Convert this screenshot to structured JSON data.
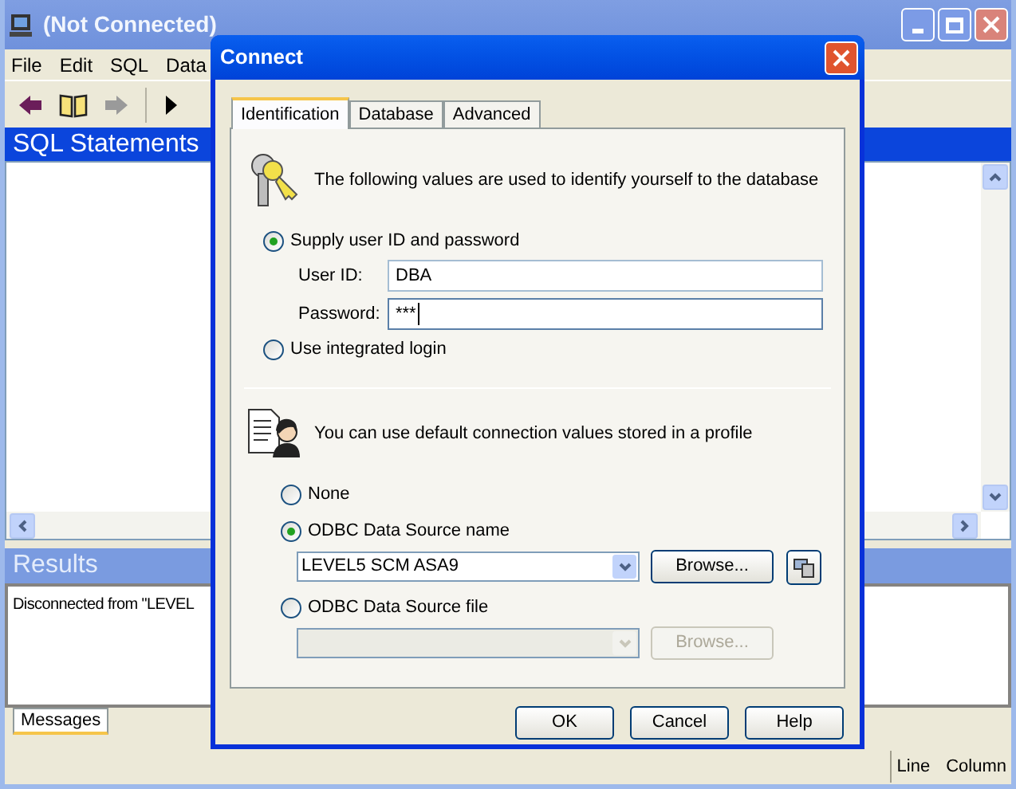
{
  "main_window": {
    "title": "(Not Connected)",
    "active": false,
    "menu": [
      "File",
      "Edit",
      "SQL",
      "Data"
    ],
    "sql_statements": {
      "title": "SQL Statements"
    },
    "results": {
      "title": "Results",
      "message": "Disconnected from \"LEVEL",
      "tabs": [
        {
          "label": "Messages",
          "selected": true
        }
      ]
    },
    "status_bar": {
      "fields": [
        "Line",
        "Column"
      ]
    }
  },
  "dialog": {
    "title": "Connect",
    "tabs": [
      {
        "label": "Identification",
        "selected": true
      },
      {
        "label": "Database",
        "selected": false
      },
      {
        "label": "Advanced",
        "selected": false
      }
    ],
    "identification": {
      "intro": "The following values are used to identify yourself to the database",
      "options": [
        {
          "label": "Supply user ID and password",
          "selected": true,
          "fields": [
            {
              "label": "User ID:",
              "value": "DBA",
              "focused": false
            },
            {
              "label": "Password:",
              "value": "***",
              "focused": true
            }
          ]
        },
        {
          "label": "Use integrated login",
          "selected": false
        }
      ]
    },
    "profile": {
      "intro": "You can use default connection values stored in a profile",
      "options": [
        {
          "label": "None",
          "selected": false
        },
        {
          "label": "ODBC Data Source name",
          "selected": true,
          "combo": {
            "value": "LEVEL5 SCM ASA9",
            "disabled": false
          },
          "browse": {
            "label": "Browse...",
            "disabled": false
          },
          "config_button": true
        },
        {
          "label": "ODBC Data Source file",
          "selected": false,
          "combo": {
            "disabled": true
          },
          "browse": {
            "label": "Browse...",
            "disabled": true
          }
        }
      ]
    },
    "buttons": [
      "OK",
      "Cancel",
      "Help"
    ]
  }
}
